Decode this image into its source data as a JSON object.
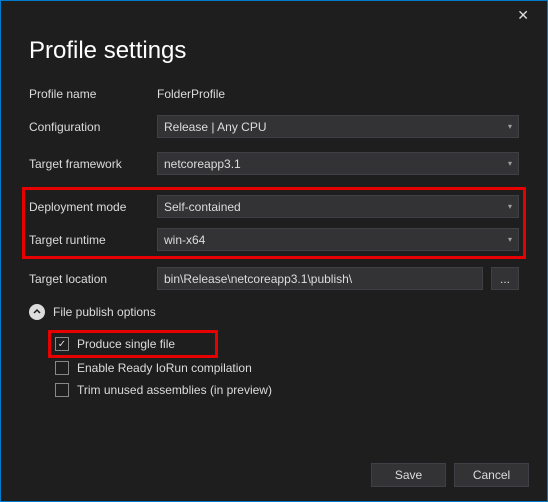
{
  "dialog": {
    "title": "Profile settings"
  },
  "fields": {
    "profileName": {
      "label": "Profile name",
      "value": "FolderProfile"
    },
    "configuration": {
      "label": "Configuration",
      "value": "Release | Any CPU"
    },
    "targetFramework": {
      "label": "Target framework",
      "value": "netcoreapp3.1"
    },
    "deploymentMode": {
      "label": "Deployment mode",
      "value": "Self-contained"
    },
    "targetRuntime": {
      "label": "Target runtime",
      "value": "win-x64"
    },
    "targetLocation": {
      "label": "Target location",
      "value": "bin\\Release\\netcoreapp3.1\\publish\\"
    }
  },
  "expander": {
    "label": "File publish options"
  },
  "options": {
    "produceSingleFile": {
      "label": "Produce single file",
      "checked": true
    },
    "readyToRun": {
      "label": "Enable Ready IoRun compilation",
      "checked": false
    },
    "trimUnused": {
      "label": "Trim unused assemblies (in preview)",
      "checked": false
    }
  },
  "buttons": {
    "browse": "...",
    "save": "Save",
    "cancel": "Cancel"
  }
}
